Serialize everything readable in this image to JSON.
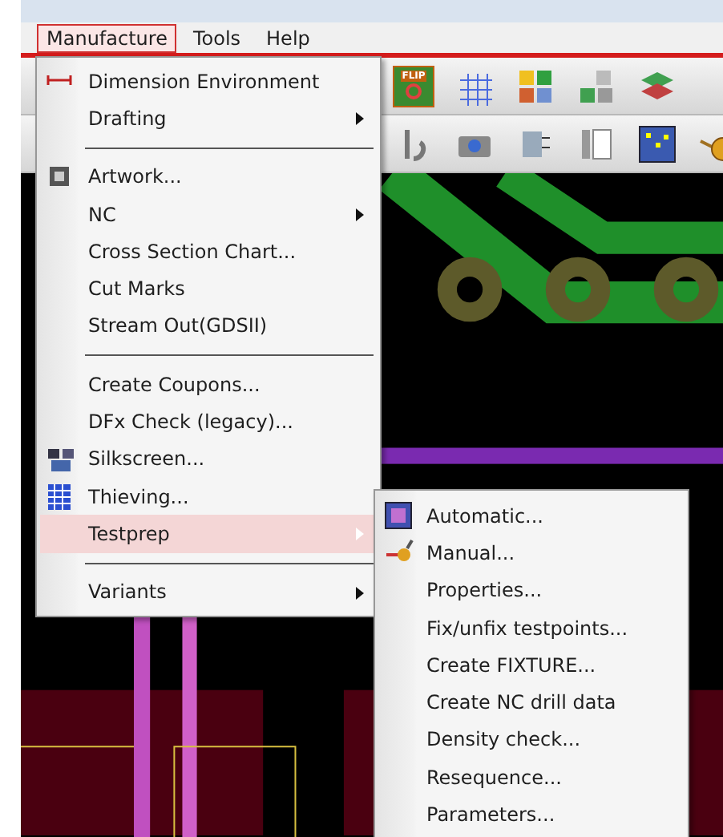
{
  "menubar": [
    {
      "label": "Manufacture",
      "selected": true
    },
    {
      "label": "Tools",
      "selected": false
    },
    {
      "label": "Help",
      "selected": false
    }
  ],
  "toolbar": {
    "flip_label": "FLIP"
  },
  "manufacture_menu": [
    {
      "kind": "item",
      "label": "Dimension Environment",
      "submenu": false,
      "selected": false
    },
    {
      "kind": "item",
      "label": "Drafting",
      "submenu": true,
      "selected": false
    },
    {
      "kind": "separator"
    },
    {
      "kind": "item",
      "label": "Artwork...",
      "submenu": false,
      "selected": false
    },
    {
      "kind": "item",
      "label": "NC",
      "submenu": true,
      "selected": false
    },
    {
      "kind": "item",
      "label": "Cross Section Chart...",
      "submenu": false,
      "selected": false
    },
    {
      "kind": "item",
      "label": "Cut Marks",
      "submenu": false,
      "selected": false
    },
    {
      "kind": "item",
      "label": "Stream Out(GDSII)",
      "submenu": false,
      "selected": false
    },
    {
      "kind": "separator"
    },
    {
      "kind": "item",
      "label": "Create Coupons...",
      "submenu": false,
      "selected": false
    },
    {
      "kind": "item",
      "label": "DFx Check (legacy)...",
      "submenu": false,
      "selected": false
    },
    {
      "kind": "item",
      "label": "Silkscreen...",
      "submenu": false,
      "selected": false
    },
    {
      "kind": "item",
      "label": "Thieving...",
      "submenu": false,
      "selected": false
    },
    {
      "kind": "item",
      "label": "Testprep",
      "submenu": true,
      "selected": true
    },
    {
      "kind": "separator"
    },
    {
      "kind": "item",
      "label": "Variants",
      "submenu": true,
      "selected": false
    }
  ],
  "testprep_menu": [
    {
      "label": "Automatic..."
    },
    {
      "label": "Manual..."
    },
    {
      "label": "Properties..."
    },
    {
      "label": "Fix/unfix testpoints..."
    },
    {
      "label": "Create FIXTURE..."
    },
    {
      "label": "Create NC drill data"
    },
    {
      "label": "Density check..."
    },
    {
      "label": "Resequence..."
    },
    {
      "label": "Parameters..."
    }
  ]
}
